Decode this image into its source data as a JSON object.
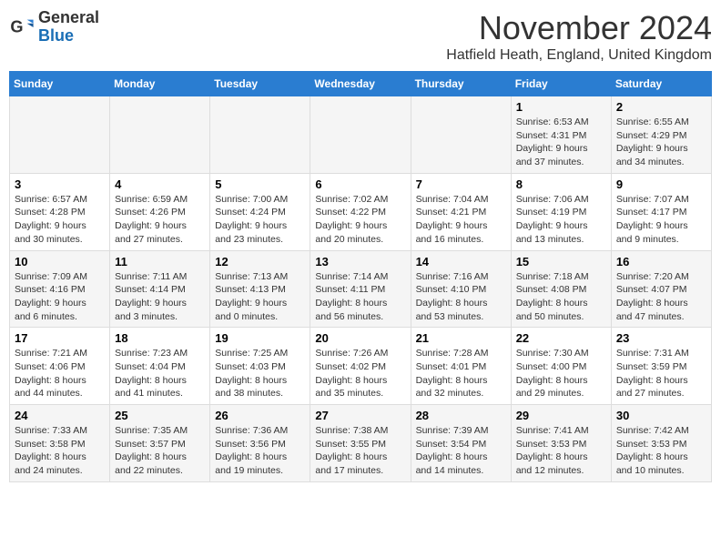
{
  "header": {
    "logo_general": "General",
    "logo_blue": "Blue",
    "title": "November 2024",
    "location": "Hatfield Heath, England, United Kingdom"
  },
  "days_of_week": [
    "Sunday",
    "Monday",
    "Tuesday",
    "Wednesday",
    "Thursday",
    "Friday",
    "Saturday"
  ],
  "weeks": [
    [
      {
        "day": "",
        "info": ""
      },
      {
        "day": "",
        "info": ""
      },
      {
        "day": "",
        "info": ""
      },
      {
        "day": "",
        "info": ""
      },
      {
        "day": "",
        "info": ""
      },
      {
        "day": "1",
        "info": "Sunrise: 6:53 AM\nSunset: 4:31 PM\nDaylight: 9 hours\nand 37 minutes."
      },
      {
        "day": "2",
        "info": "Sunrise: 6:55 AM\nSunset: 4:29 PM\nDaylight: 9 hours\nand 34 minutes."
      }
    ],
    [
      {
        "day": "3",
        "info": "Sunrise: 6:57 AM\nSunset: 4:28 PM\nDaylight: 9 hours\nand 30 minutes."
      },
      {
        "day": "4",
        "info": "Sunrise: 6:59 AM\nSunset: 4:26 PM\nDaylight: 9 hours\nand 27 minutes."
      },
      {
        "day": "5",
        "info": "Sunrise: 7:00 AM\nSunset: 4:24 PM\nDaylight: 9 hours\nand 23 minutes."
      },
      {
        "day": "6",
        "info": "Sunrise: 7:02 AM\nSunset: 4:22 PM\nDaylight: 9 hours\nand 20 minutes."
      },
      {
        "day": "7",
        "info": "Sunrise: 7:04 AM\nSunset: 4:21 PM\nDaylight: 9 hours\nand 16 minutes."
      },
      {
        "day": "8",
        "info": "Sunrise: 7:06 AM\nSunset: 4:19 PM\nDaylight: 9 hours\nand 13 minutes."
      },
      {
        "day": "9",
        "info": "Sunrise: 7:07 AM\nSunset: 4:17 PM\nDaylight: 9 hours\nand 9 minutes."
      }
    ],
    [
      {
        "day": "10",
        "info": "Sunrise: 7:09 AM\nSunset: 4:16 PM\nDaylight: 9 hours\nand 6 minutes."
      },
      {
        "day": "11",
        "info": "Sunrise: 7:11 AM\nSunset: 4:14 PM\nDaylight: 9 hours\nand 3 minutes."
      },
      {
        "day": "12",
        "info": "Sunrise: 7:13 AM\nSunset: 4:13 PM\nDaylight: 9 hours\nand 0 minutes."
      },
      {
        "day": "13",
        "info": "Sunrise: 7:14 AM\nSunset: 4:11 PM\nDaylight: 8 hours\nand 56 minutes."
      },
      {
        "day": "14",
        "info": "Sunrise: 7:16 AM\nSunset: 4:10 PM\nDaylight: 8 hours\nand 53 minutes."
      },
      {
        "day": "15",
        "info": "Sunrise: 7:18 AM\nSunset: 4:08 PM\nDaylight: 8 hours\nand 50 minutes."
      },
      {
        "day": "16",
        "info": "Sunrise: 7:20 AM\nSunset: 4:07 PM\nDaylight: 8 hours\nand 47 minutes."
      }
    ],
    [
      {
        "day": "17",
        "info": "Sunrise: 7:21 AM\nSunset: 4:06 PM\nDaylight: 8 hours\nand 44 minutes."
      },
      {
        "day": "18",
        "info": "Sunrise: 7:23 AM\nSunset: 4:04 PM\nDaylight: 8 hours\nand 41 minutes."
      },
      {
        "day": "19",
        "info": "Sunrise: 7:25 AM\nSunset: 4:03 PM\nDaylight: 8 hours\nand 38 minutes."
      },
      {
        "day": "20",
        "info": "Sunrise: 7:26 AM\nSunset: 4:02 PM\nDaylight: 8 hours\nand 35 minutes."
      },
      {
        "day": "21",
        "info": "Sunrise: 7:28 AM\nSunset: 4:01 PM\nDaylight: 8 hours\nand 32 minutes."
      },
      {
        "day": "22",
        "info": "Sunrise: 7:30 AM\nSunset: 4:00 PM\nDaylight: 8 hours\nand 29 minutes."
      },
      {
        "day": "23",
        "info": "Sunrise: 7:31 AM\nSunset: 3:59 PM\nDaylight: 8 hours\nand 27 minutes."
      }
    ],
    [
      {
        "day": "24",
        "info": "Sunrise: 7:33 AM\nSunset: 3:58 PM\nDaylight: 8 hours\nand 24 minutes."
      },
      {
        "day": "25",
        "info": "Sunrise: 7:35 AM\nSunset: 3:57 PM\nDaylight: 8 hours\nand 22 minutes."
      },
      {
        "day": "26",
        "info": "Sunrise: 7:36 AM\nSunset: 3:56 PM\nDaylight: 8 hours\nand 19 minutes."
      },
      {
        "day": "27",
        "info": "Sunrise: 7:38 AM\nSunset: 3:55 PM\nDaylight: 8 hours\nand 17 minutes."
      },
      {
        "day": "28",
        "info": "Sunrise: 7:39 AM\nSunset: 3:54 PM\nDaylight: 8 hours\nand 14 minutes."
      },
      {
        "day": "29",
        "info": "Sunrise: 7:41 AM\nSunset: 3:53 PM\nDaylight: 8 hours\nand 12 minutes."
      },
      {
        "day": "30",
        "info": "Sunrise: 7:42 AM\nSunset: 3:53 PM\nDaylight: 8 hours\nand 10 minutes."
      }
    ]
  ]
}
